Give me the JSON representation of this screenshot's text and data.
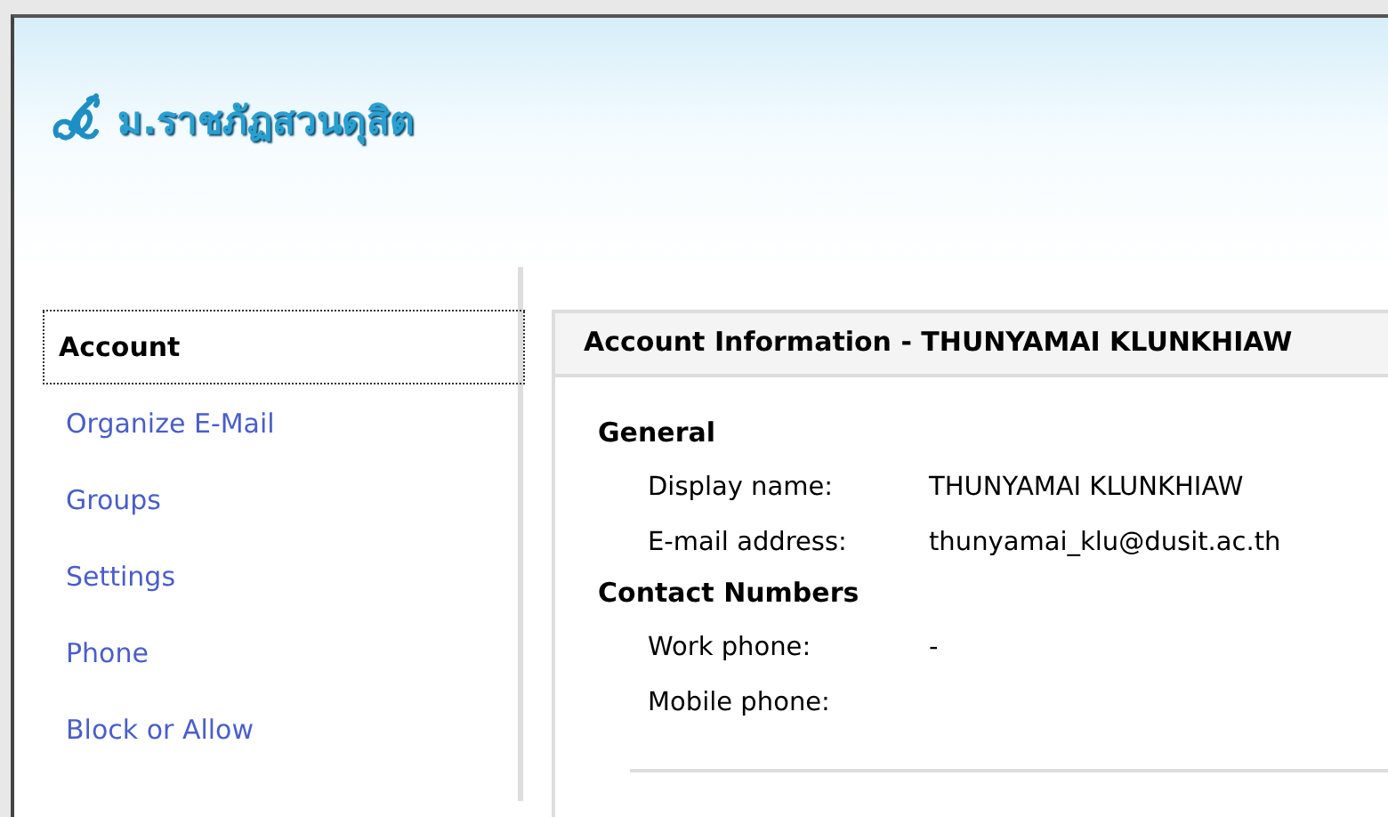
{
  "header": {
    "logo_text": "ม.ราชภัฏสวนดุสิต"
  },
  "sidebar": {
    "items": [
      {
        "label": "Account",
        "selected": true
      },
      {
        "label": "Organize E-Mail",
        "selected": false
      },
      {
        "label": "Groups",
        "selected": false
      },
      {
        "label": "Settings",
        "selected": false
      },
      {
        "label": "Phone",
        "selected": false
      },
      {
        "label": "Block or Allow",
        "selected": false
      }
    ]
  },
  "panel": {
    "title": "Account Information - THUNYAMAI KLUNKHIAW",
    "sections": [
      {
        "heading": "General",
        "fields": [
          {
            "label": "Display name:",
            "value": "THUNYAMAI KLUNKHIAW"
          },
          {
            "label": "E-mail address:",
            "value": "thunyamai_klu@dusit.ac.th"
          }
        ]
      },
      {
        "heading": "Contact Numbers",
        "fields": [
          {
            "label": "Work phone:",
            "value": "-"
          },
          {
            "label": "Mobile phone:"
          }
        ]
      }
    ]
  }
}
